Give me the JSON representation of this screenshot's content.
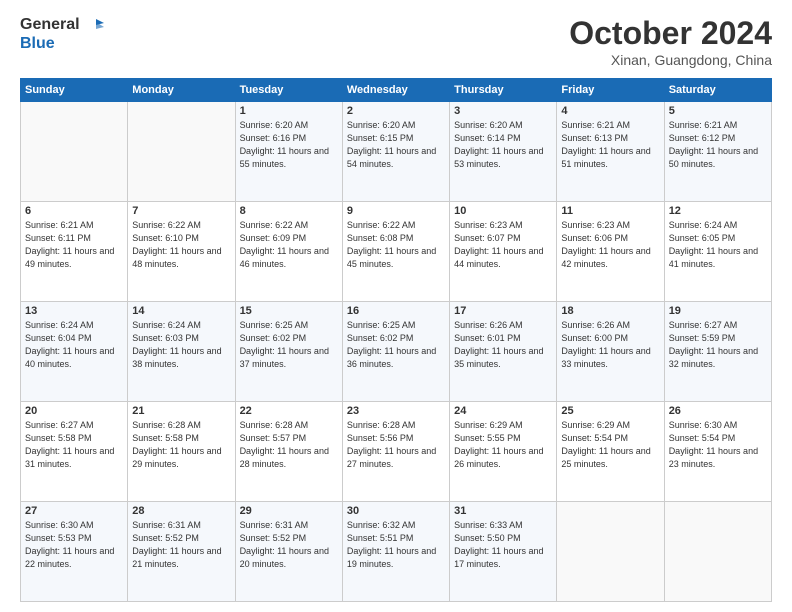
{
  "logo": {
    "line1": "General",
    "line2": "Blue"
  },
  "header": {
    "month": "October 2024",
    "location": "Xinan, Guangdong, China"
  },
  "weekdays": [
    "Sunday",
    "Monday",
    "Tuesday",
    "Wednesday",
    "Thursday",
    "Friday",
    "Saturday"
  ],
  "weeks": [
    [
      {
        "day": "",
        "sunrise": "",
        "sunset": "",
        "daylight": ""
      },
      {
        "day": "",
        "sunrise": "",
        "sunset": "",
        "daylight": ""
      },
      {
        "day": "1",
        "sunrise": "Sunrise: 6:20 AM",
        "sunset": "Sunset: 6:16 PM",
        "daylight": "Daylight: 11 hours and 55 minutes."
      },
      {
        "day": "2",
        "sunrise": "Sunrise: 6:20 AM",
        "sunset": "Sunset: 6:15 PM",
        "daylight": "Daylight: 11 hours and 54 minutes."
      },
      {
        "day": "3",
        "sunrise": "Sunrise: 6:20 AM",
        "sunset": "Sunset: 6:14 PM",
        "daylight": "Daylight: 11 hours and 53 minutes."
      },
      {
        "day": "4",
        "sunrise": "Sunrise: 6:21 AM",
        "sunset": "Sunset: 6:13 PM",
        "daylight": "Daylight: 11 hours and 51 minutes."
      },
      {
        "day": "5",
        "sunrise": "Sunrise: 6:21 AM",
        "sunset": "Sunset: 6:12 PM",
        "daylight": "Daylight: 11 hours and 50 minutes."
      }
    ],
    [
      {
        "day": "6",
        "sunrise": "Sunrise: 6:21 AM",
        "sunset": "Sunset: 6:11 PM",
        "daylight": "Daylight: 11 hours and 49 minutes."
      },
      {
        "day": "7",
        "sunrise": "Sunrise: 6:22 AM",
        "sunset": "Sunset: 6:10 PM",
        "daylight": "Daylight: 11 hours and 48 minutes."
      },
      {
        "day": "8",
        "sunrise": "Sunrise: 6:22 AM",
        "sunset": "Sunset: 6:09 PM",
        "daylight": "Daylight: 11 hours and 46 minutes."
      },
      {
        "day": "9",
        "sunrise": "Sunrise: 6:22 AM",
        "sunset": "Sunset: 6:08 PM",
        "daylight": "Daylight: 11 hours and 45 minutes."
      },
      {
        "day": "10",
        "sunrise": "Sunrise: 6:23 AM",
        "sunset": "Sunset: 6:07 PM",
        "daylight": "Daylight: 11 hours and 44 minutes."
      },
      {
        "day": "11",
        "sunrise": "Sunrise: 6:23 AM",
        "sunset": "Sunset: 6:06 PM",
        "daylight": "Daylight: 11 hours and 42 minutes."
      },
      {
        "day": "12",
        "sunrise": "Sunrise: 6:24 AM",
        "sunset": "Sunset: 6:05 PM",
        "daylight": "Daylight: 11 hours and 41 minutes."
      }
    ],
    [
      {
        "day": "13",
        "sunrise": "Sunrise: 6:24 AM",
        "sunset": "Sunset: 6:04 PM",
        "daylight": "Daylight: 11 hours and 40 minutes."
      },
      {
        "day": "14",
        "sunrise": "Sunrise: 6:24 AM",
        "sunset": "Sunset: 6:03 PM",
        "daylight": "Daylight: 11 hours and 38 minutes."
      },
      {
        "day": "15",
        "sunrise": "Sunrise: 6:25 AM",
        "sunset": "Sunset: 6:02 PM",
        "daylight": "Daylight: 11 hours and 37 minutes."
      },
      {
        "day": "16",
        "sunrise": "Sunrise: 6:25 AM",
        "sunset": "Sunset: 6:02 PM",
        "daylight": "Daylight: 11 hours and 36 minutes."
      },
      {
        "day": "17",
        "sunrise": "Sunrise: 6:26 AM",
        "sunset": "Sunset: 6:01 PM",
        "daylight": "Daylight: 11 hours and 35 minutes."
      },
      {
        "day": "18",
        "sunrise": "Sunrise: 6:26 AM",
        "sunset": "Sunset: 6:00 PM",
        "daylight": "Daylight: 11 hours and 33 minutes."
      },
      {
        "day": "19",
        "sunrise": "Sunrise: 6:27 AM",
        "sunset": "Sunset: 5:59 PM",
        "daylight": "Daylight: 11 hours and 32 minutes."
      }
    ],
    [
      {
        "day": "20",
        "sunrise": "Sunrise: 6:27 AM",
        "sunset": "Sunset: 5:58 PM",
        "daylight": "Daylight: 11 hours and 31 minutes."
      },
      {
        "day": "21",
        "sunrise": "Sunrise: 6:28 AM",
        "sunset": "Sunset: 5:58 PM",
        "daylight": "Daylight: 11 hours and 29 minutes."
      },
      {
        "day": "22",
        "sunrise": "Sunrise: 6:28 AM",
        "sunset": "Sunset: 5:57 PM",
        "daylight": "Daylight: 11 hours and 28 minutes."
      },
      {
        "day": "23",
        "sunrise": "Sunrise: 6:28 AM",
        "sunset": "Sunset: 5:56 PM",
        "daylight": "Daylight: 11 hours and 27 minutes."
      },
      {
        "day": "24",
        "sunrise": "Sunrise: 6:29 AM",
        "sunset": "Sunset: 5:55 PM",
        "daylight": "Daylight: 11 hours and 26 minutes."
      },
      {
        "day": "25",
        "sunrise": "Sunrise: 6:29 AM",
        "sunset": "Sunset: 5:54 PM",
        "daylight": "Daylight: 11 hours and 25 minutes."
      },
      {
        "day": "26",
        "sunrise": "Sunrise: 6:30 AM",
        "sunset": "Sunset: 5:54 PM",
        "daylight": "Daylight: 11 hours and 23 minutes."
      }
    ],
    [
      {
        "day": "27",
        "sunrise": "Sunrise: 6:30 AM",
        "sunset": "Sunset: 5:53 PM",
        "daylight": "Daylight: 11 hours and 22 minutes."
      },
      {
        "day": "28",
        "sunrise": "Sunrise: 6:31 AM",
        "sunset": "Sunset: 5:52 PM",
        "daylight": "Daylight: 11 hours and 21 minutes."
      },
      {
        "day": "29",
        "sunrise": "Sunrise: 6:31 AM",
        "sunset": "Sunset: 5:52 PM",
        "daylight": "Daylight: 11 hours and 20 minutes."
      },
      {
        "day": "30",
        "sunrise": "Sunrise: 6:32 AM",
        "sunset": "Sunset: 5:51 PM",
        "daylight": "Daylight: 11 hours and 19 minutes."
      },
      {
        "day": "31",
        "sunrise": "Sunrise: 6:33 AM",
        "sunset": "Sunset: 5:50 PM",
        "daylight": "Daylight: 11 hours and 17 minutes."
      },
      {
        "day": "",
        "sunrise": "",
        "sunset": "",
        "daylight": ""
      },
      {
        "day": "",
        "sunrise": "",
        "sunset": "",
        "daylight": ""
      }
    ]
  ]
}
